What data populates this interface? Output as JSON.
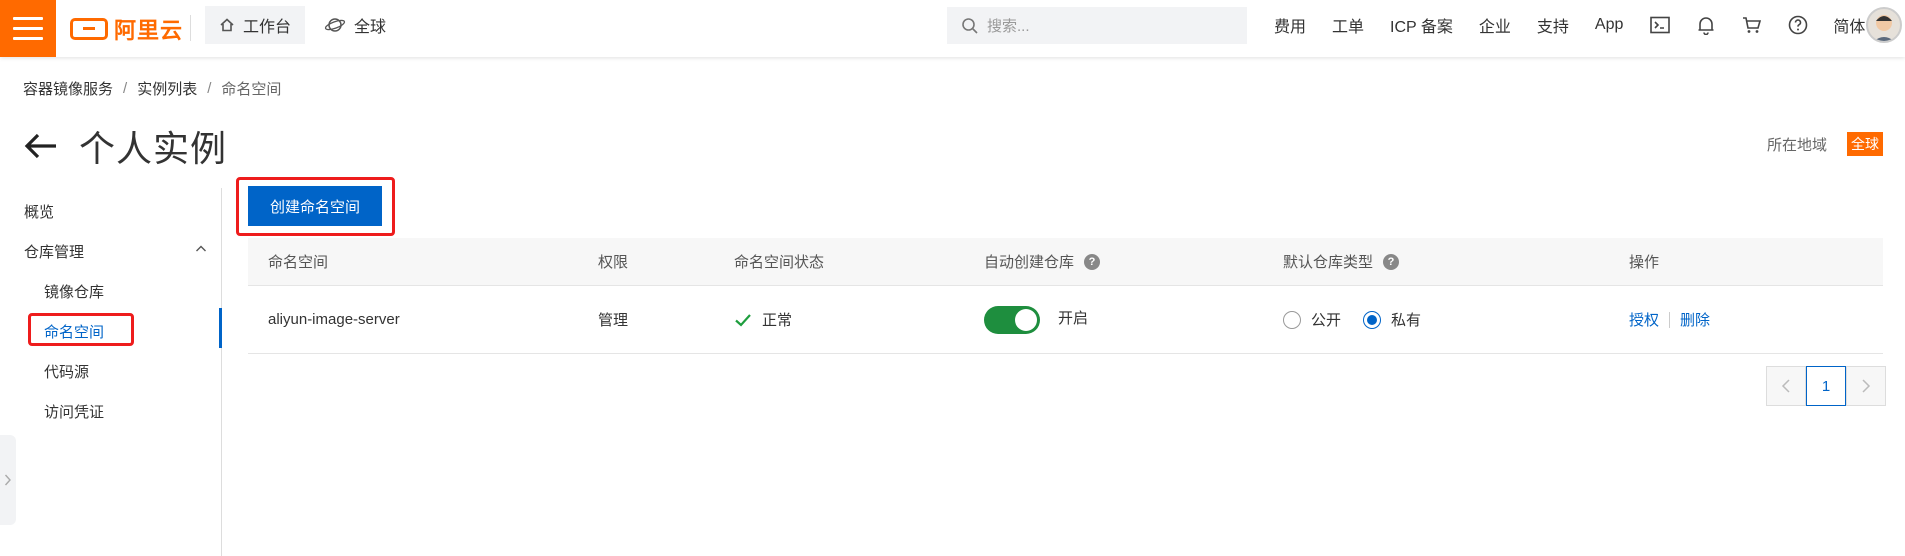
{
  "header": {
    "logo_text": "阿里云",
    "nav": [
      {
        "label": "工作台",
        "icon": "home-icon",
        "active": true
      },
      {
        "label": "全球",
        "icon": "globe-icon",
        "active": false
      }
    ],
    "search_placeholder": "搜索...",
    "links": [
      "费用",
      "工单",
      "ICP 备案",
      "企业",
      "支持",
      "App"
    ],
    "icons": [
      "terminal-icon",
      "bell-icon",
      "cart-icon",
      "help-circle-icon"
    ],
    "language": "简体",
    "accent_color": "#ff6a00"
  },
  "breadcrumb": [
    "容器镜像服务",
    "实例列表",
    "命名空间"
  ],
  "page_title": "个人实例",
  "region": {
    "label": "所在地域",
    "value": "全球"
  },
  "sidebar": {
    "items": [
      {
        "label": "概览"
      },
      {
        "label": "仓库管理",
        "expanded": true
      },
      {
        "label": "镜像仓库"
      },
      {
        "label": "命名空间",
        "active": true
      },
      {
        "label": "代码源"
      },
      {
        "label": "访问凭证"
      }
    ]
  },
  "toolbar": {
    "create_label": "创建命名空间"
  },
  "table": {
    "columns": [
      "命名空间",
      "权限",
      "命名空间状态",
      "自动创建仓库",
      "默认仓库类型",
      "操作"
    ],
    "rows": [
      {
        "name": "aliyun-image-server",
        "permission": "管理",
        "status": "正常",
        "auto_create": {
          "on": true,
          "label": "开启"
        },
        "repo_type_options": [
          "公开",
          "私有"
        ],
        "repo_type_selected": "私有",
        "actions": [
          "授权",
          "删除"
        ]
      }
    ]
  },
  "pagination": {
    "current_page": "1"
  }
}
